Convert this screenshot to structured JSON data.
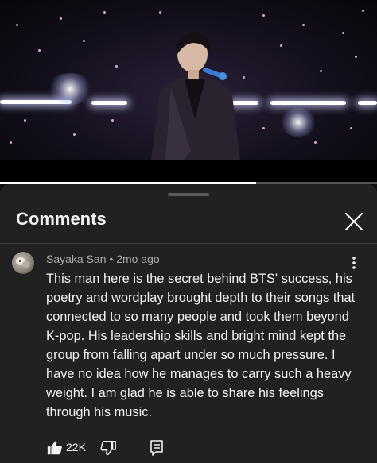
{
  "video": {
    "progress_fraction": 0.68
  },
  "comments_panel": {
    "title": "Comments",
    "close_icon": "close-icon"
  },
  "comment": {
    "author": "Sayaka San",
    "separator": "•",
    "time": "2mo ago",
    "text": "This man here is the secret behind BTS' success, his poetry and wordplay brought depth to their songs that connected to so many people and took them beyond K-pop. His leadership skills and bright mind kept the group from falling apart under so much pressure. I have no idea how he manages to carry such a heavy weight. I am glad he is able to share his feelings through his music.",
    "like_count": "22K",
    "icons": {
      "more": "more-vert-icon",
      "like": "thumbs-up-icon",
      "dislike": "thumbs-down-icon",
      "reply": "reply-icon"
    }
  },
  "colors": {
    "background": "#0f0f0f",
    "sheet": "#212121",
    "text_primary": "#f1f1f1",
    "text_secondary": "#aaaaaa"
  }
}
